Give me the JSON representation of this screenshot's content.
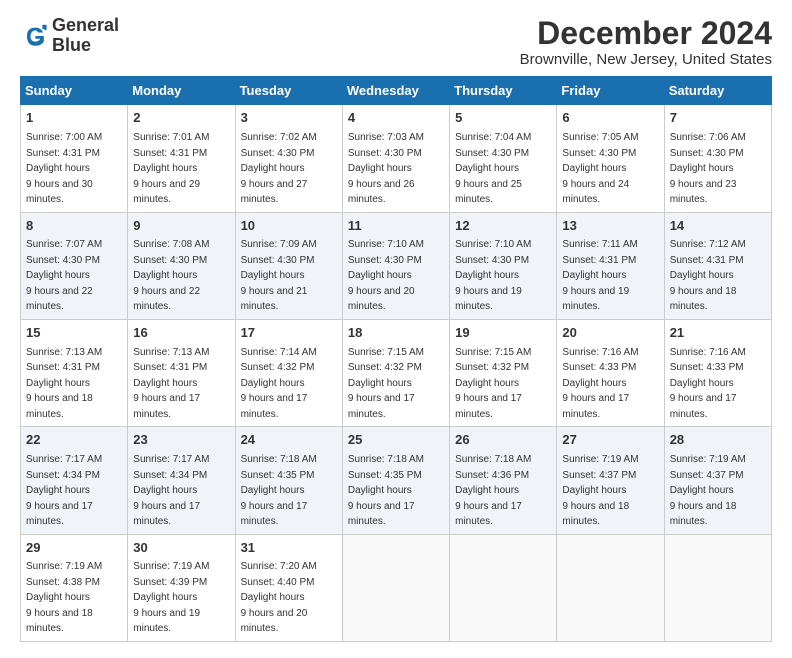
{
  "app": {
    "name": "GeneralBlue",
    "logo_line1": "General",
    "logo_line2": "Blue"
  },
  "title": "December 2024",
  "subtitle": "Brownville, New Jersey, United States",
  "headers": [
    "Sunday",
    "Monday",
    "Tuesday",
    "Wednesday",
    "Thursday",
    "Friday",
    "Saturday"
  ],
  "weeks": [
    [
      {
        "day": "1",
        "sunrise": "7:00 AM",
        "sunset": "4:31 PM",
        "daylight": "9 hours and 30 minutes."
      },
      {
        "day": "2",
        "sunrise": "7:01 AM",
        "sunset": "4:31 PM",
        "daylight": "9 hours and 29 minutes."
      },
      {
        "day": "3",
        "sunrise": "7:02 AM",
        "sunset": "4:30 PM",
        "daylight": "9 hours and 27 minutes."
      },
      {
        "day": "4",
        "sunrise": "7:03 AM",
        "sunset": "4:30 PM",
        "daylight": "9 hours and 26 minutes."
      },
      {
        "day": "5",
        "sunrise": "7:04 AM",
        "sunset": "4:30 PM",
        "daylight": "9 hours and 25 minutes."
      },
      {
        "day": "6",
        "sunrise": "7:05 AM",
        "sunset": "4:30 PM",
        "daylight": "9 hours and 24 minutes."
      },
      {
        "day": "7",
        "sunrise": "7:06 AM",
        "sunset": "4:30 PM",
        "daylight": "9 hours and 23 minutes."
      }
    ],
    [
      {
        "day": "8",
        "sunrise": "7:07 AM",
        "sunset": "4:30 PM",
        "daylight": "9 hours and 22 minutes."
      },
      {
        "day": "9",
        "sunrise": "7:08 AM",
        "sunset": "4:30 PM",
        "daylight": "9 hours and 22 minutes."
      },
      {
        "day": "10",
        "sunrise": "7:09 AM",
        "sunset": "4:30 PM",
        "daylight": "9 hours and 21 minutes."
      },
      {
        "day": "11",
        "sunrise": "7:10 AM",
        "sunset": "4:30 PM",
        "daylight": "9 hours and 20 minutes."
      },
      {
        "day": "12",
        "sunrise": "7:10 AM",
        "sunset": "4:30 PM",
        "daylight": "9 hours and 19 minutes."
      },
      {
        "day": "13",
        "sunrise": "7:11 AM",
        "sunset": "4:31 PM",
        "daylight": "9 hours and 19 minutes."
      },
      {
        "day": "14",
        "sunrise": "7:12 AM",
        "sunset": "4:31 PM",
        "daylight": "9 hours and 18 minutes."
      }
    ],
    [
      {
        "day": "15",
        "sunrise": "7:13 AM",
        "sunset": "4:31 PM",
        "daylight": "9 hours and 18 minutes."
      },
      {
        "day": "16",
        "sunrise": "7:13 AM",
        "sunset": "4:31 PM",
        "daylight": "9 hours and 17 minutes."
      },
      {
        "day": "17",
        "sunrise": "7:14 AM",
        "sunset": "4:32 PM",
        "daylight": "9 hours and 17 minutes."
      },
      {
        "day": "18",
        "sunrise": "7:15 AM",
        "sunset": "4:32 PM",
        "daylight": "9 hours and 17 minutes."
      },
      {
        "day": "19",
        "sunrise": "7:15 AM",
        "sunset": "4:32 PM",
        "daylight": "9 hours and 17 minutes."
      },
      {
        "day": "20",
        "sunrise": "7:16 AM",
        "sunset": "4:33 PM",
        "daylight": "9 hours and 17 minutes."
      },
      {
        "day": "21",
        "sunrise": "7:16 AM",
        "sunset": "4:33 PM",
        "daylight": "9 hours and 17 minutes."
      }
    ],
    [
      {
        "day": "22",
        "sunrise": "7:17 AM",
        "sunset": "4:34 PM",
        "daylight": "9 hours and 17 minutes."
      },
      {
        "day": "23",
        "sunrise": "7:17 AM",
        "sunset": "4:34 PM",
        "daylight": "9 hours and 17 minutes."
      },
      {
        "day": "24",
        "sunrise": "7:18 AM",
        "sunset": "4:35 PM",
        "daylight": "9 hours and 17 minutes."
      },
      {
        "day": "25",
        "sunrise": "7:18 AM",
        "sunset": "4:35 PM",
        "daylight": "9 hours and 17 minutes."
      },
      {
        "day": "26",
        "sunrise": "7:18 AM",
        "sunset": "4:36 PM",
        "daylight": "9 hours and 17 minutes."
      },
      {
        "day": "27",
        "sunrise": "7:19 AM",
        "sunset": "4:37 PM",
        "daylight": "9 hours and 18 minutes."
      },
      {
        "day": "28",
        "sunrise": "7:19 AM",
        "sunset": "4:37 PM",
        "daylight": "9 hours and 18 minutes."
      }
    ],
    [
      {
        "day": "29",
        "sunrise": "7:19 AM",
        "sunset": "4:38 PM",
        "daylight": "9 hours and 18 minutes."
      },
      {
        "day": "30",
        "sunrise": "7:19 AM",
        "sunset": "4:39 PM",
        "daylight": "9 hours and 19 minutes."
      },
      {
        "day": "31",
        "sunrise": "7:20 AM",
        "sunset": "4:40 PM",
        "daylight": "9 hours and 20 minutes."
      },
      null,
      null,
      null,
      null
    ]
  ]
}
